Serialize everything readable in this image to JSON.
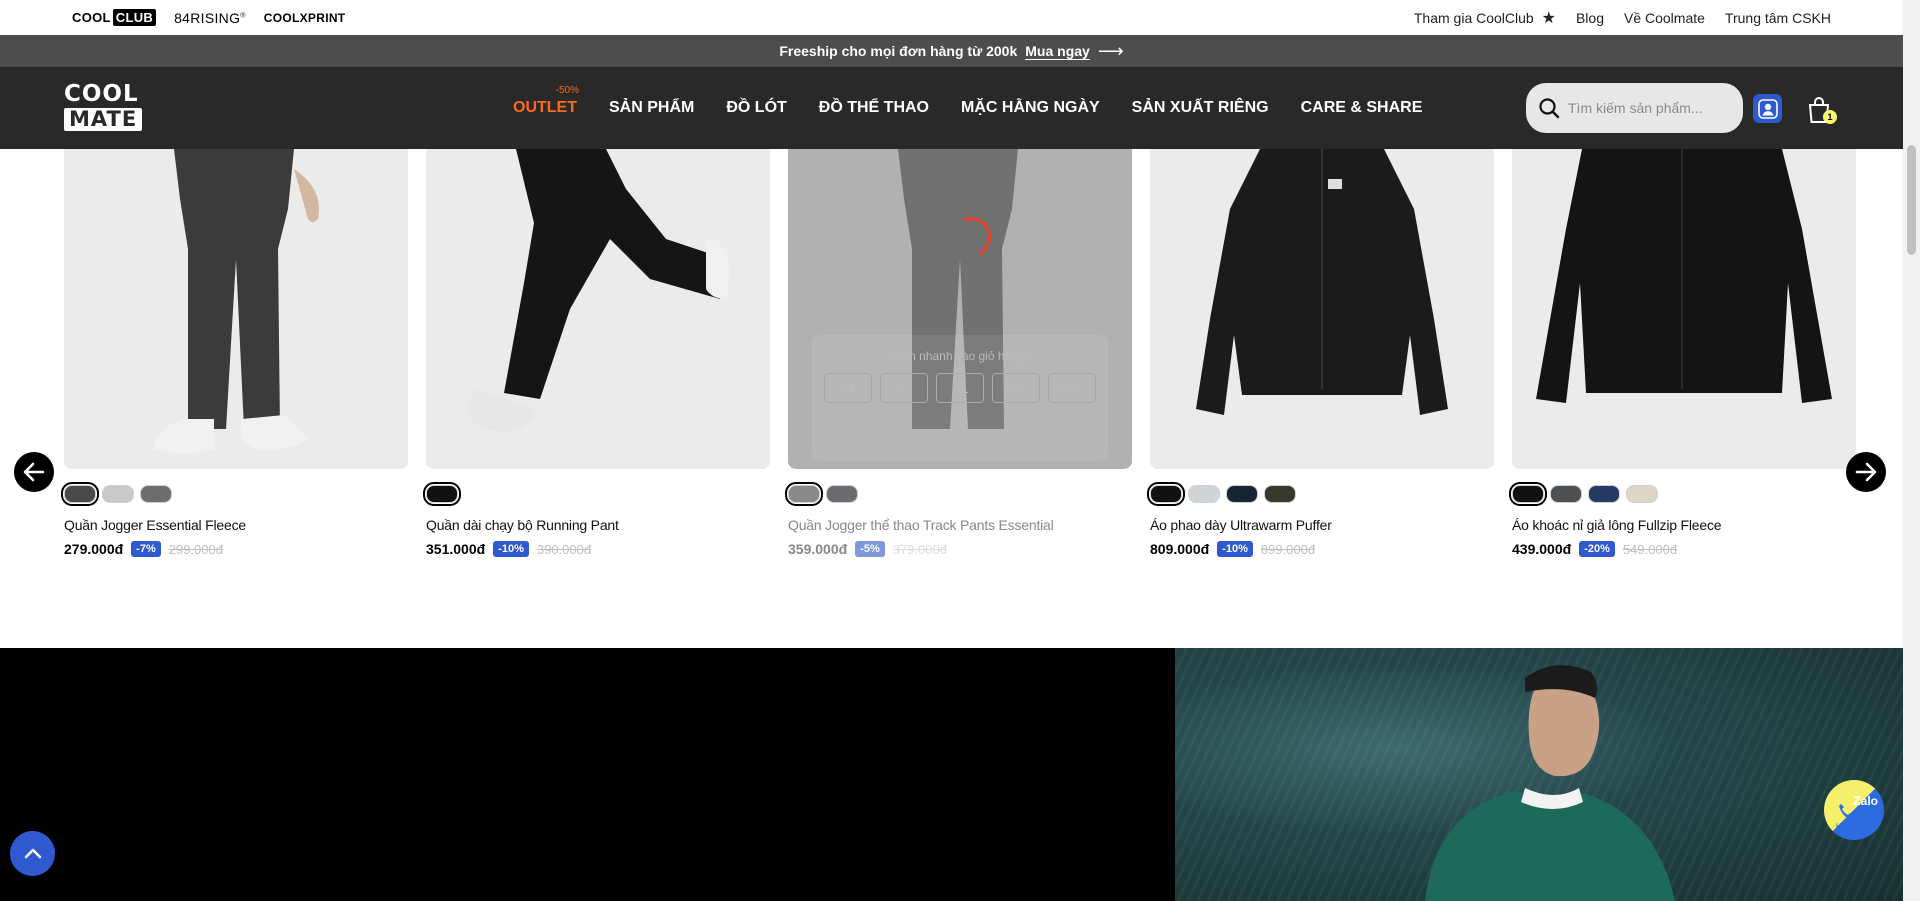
{
  "topbar": {
    "brands": {
      "coolclub_a": "COOL",
      "coolclub_b": "CLUB",
      "rising": "84RISING",
      "rising_mark": "®",
      "coolxprint": "COOLXPRINT"
    },
    "links": [
      "Tham gia CoolClub",
      "Blog",
      "Về Coolmate",
      "Trung tâm CSKH"
    ]
  },
  "promo": {
    "text": "Freeship cho mọi đơn hàng từ 200k",
    "cta": "Mua ngay"
  },
  "header": {
    "logo": {
      "line1": "COOL",
      "line2": "MATE"
    },
    "nav": [
      {
        "label": "OUTLET",
        "badge": "-50%"
      },
      {
        "label": "SẢN PHẨM"
      },
      {
        "label": "ĐỒ LÓT"
      },
      {
        "label": "ĐỒ THỂ THAO"
      },
      {
        "label": "MẶC HẰNG NGÀY"
      },
      {
        "label": "SẢN XUẤT RIÊNG"
      },
      {
        "label": "CARE & SHARE"
      }
    ],
    "search_placeholder": "Tìm kiếm sản phẩm...",
    "cart_count": "1"
  },
  "products": [
    {
      "name": "Quần Jogger Essential Fleece",
      "price": "279.000đ",
      "discount": "-7%",
      "old_price": "299.000đ",
      "swatches": [
        "#4a4a4a",
        "#c9c9c9",
        "#6d6d6d"
      ]
    },
    {
      "name": "Quần dài chạy bộ Running Pant",
      "price": "351.000đ",
      "discount": "-10%",
      "old_price": "390.000đ",
      "swatches": [
        "#111111"
      ]
    },
    {
      "name": "Quần Jogger thể thao Track Pants Essential",
      "price": "359.000đ",
      "discount": "-5%",
      "old_price": "379.000đ",
      "swatches": [
        "#8a8a8a",
        "#6c6c70"
      ],
      "quick_add": {
        "title": "Thêm nhanh vào giỏ hàng +",
        "sizes": [
          "M",
          "L",
          "XL",
          "2XL",
          "3XL"
        ]
      }
    },
    {
      "name": "Áo phao dày Ultrawarm Puffer",
      "price": "809.000đ",
      "discount": "-10%",
      "old_price": "899.000đ",
      "swatches": [
        "#111111",
        "#cfd4d6",
        "#172433",
        "#363a2a"
      ]
    },
    {
      "name": "Áo khoác nỉ giả lông Fullzip Fleece",
      "price": "439.000đ",
      "discount": "-20%",
      "old_price": "549.000đ",
      "swatches": [
        "#111111",
        "#4d4f51",
        "#253a63",
        "#ddd6c4"
      ]
    }
  ],
  "zalo": {
    "label": "Zalo",
    "hotline": "Hotline"
  },
  "colors": {
    "accent": "#2f5acf",
    "outlet": "#ff6a1a",
    "header_bg": "#292929",
    "promo_bg": "#4d4d4d"
  },
  "icons": [
    "search-icon",
    "user-icon",
    "cart-icon",
    "arrow-left-icon",
    "arrow-right-icon",
    "chevron-up-icon",
    "star-icon",
    "phone-icon"
  ]
}
